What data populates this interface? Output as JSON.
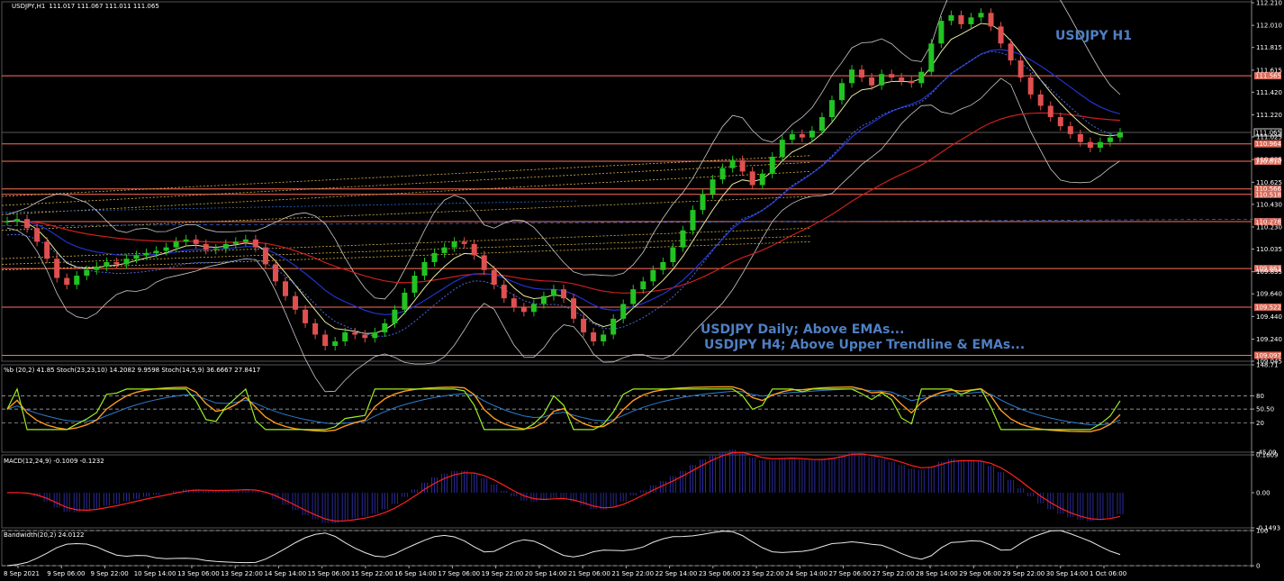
{
  "chart_data": {
    "type": "line",
    "header": {
      "symbol": "USDJPY,H1",
      "ohlc": "111.017 111.067 111.011 111.065"
    },
    "annotations": {
      "title": "USDJPY H1",
      "note1": "USDJPY Daily; Above EMAs...",
      "note2": "USDJPY H4; Above Upper Trendline & EMAs..."
    },
    "price_axis": {
      "ylim": [
        109.045,
        112.218
      ],
      "ticks": [
        "112.210",
        "112.010",
        "111.815",
        "111.615",
        "111.420",
        "111.220",
        "111.025",
        "110.825",
        "110.625",
        "110.430",
        "110.230",
        "110.035",
        "109.835",
        "109.640",
        "109.440",
        "109.240",
        "109.045"
      ],
      "tick_values": [
        112.21,
        112.01,
        111.815,
        111.615,
        111.42,
        111.22,
        111.025,
        110.825,
        110.625,
        110.43,
        110.23,
        110.035,
        109.835,
        109.64,
        109.44,
        109.24,
        109.045
      ]
    },
    "horizontal_levels": [
      {
        "label": "111.565",
        "value": 111.565
      },
      {
        "label": "110.964",
        "value": 110.964
      },
      {
        "label": "110.810",
        "value": 110.81
      },
      {
        "label": "110.566",
        "value": 110.566
      },
      {
        "label": "110.518",
        "value": 110.518
      },
      {
        "label": "110.278",
        "value": 110.278
      },
      {
        "label": "109.863",
        "value": 109.863
      },
      {
        "label": "109.522",
        "value": 109.522
      },
      {
        "label": "109.097",
        "value": 109.097
      }
    ],
    "current_price": {
      "label": "111.065",
      "value": 111.065
    },
    "price_series": {
      "name": "USDJPY close (approx.)",
      "values": [
        110.28,
        110.3,
        110.22,
        110.1,
        109.95,
        109.78,
        109.72,
        109.8,
        109.85,
        109.88,
        109.92,
        109.9,
        109.95,
        109.98,
        110.0,
        110.02,
        110.05,
        110.1,
        110.12,
        110.08,
        110.03,
        110.04,
        110.08,
        110.1,
        110.12,
        110.05,
        109.9,
        109.75,
        109.62,
        109.5,
        109.38,
        109.28,
        109.18,
        109.22,
        109.3,
        109.28,
        109.25,
        109.3,
        109.38,
        109.5,
        109.65,
        109.8,
        109.92,
        110.0,
        110.05,
        110.1,
        110.08,
        109.98,
        109.85,
        109.72,
        109.6,
        109.52,
        109.48,
        109.55,
        109.62,
        109.68,
        109.6,
        109.42,
        109.3,
        109.22,
        109.28,
        109.42,
        109.55,
        109.68,
        109.75,
        109.85,
        109.92,
        110.05,
        110.2,
        110.38,
        110.52,
        110.65,
        110.75,
        110.82,
        110.72,
        110.6,
        110.7,
        110.85,
        111.0,
        111.05,
        111.02,
        111.08,
        111.2,
        111.35,
        111.5,
        111.62,
        111.55,
        111.48,
        111.58,
        111.55,
        111.52,
        111.5,
        111.6,
        111.85,
        112.05,
        112.1,
        112.02,
        112.08,
        112.12,
        112.0,
        111.85,
        111.7,
        111.55,
        111.4,
        111.3,
        111.2,
        111.12,
        111.05,
        110.98,
        110.93,
        110.98,
        111.02,
        111.065
      ]
    },
    "indicators": {
      "stoch_panel": {
        "header": "%b (20,2) 41.85  Stoch(23,23,10) 14.2082 9.9598  Stoch(14,5,9) 36.6667 27.8417",
        "axis_ticks": [
          "148.71",
          "80",
          "50.50",
          "20",
          "-45.09"
        ],
        "tick_values": [
          148.71,
          80,
          50.5,
          20,
          -45.09
        ],
        "ylim": [
          -45.09,
          148.71
        ]
      },
      "macd_panel": {
        "header": "MACD(12,24,9) -0.1009 -0.1232",
        "axis_ticks": [
          "0.1609",
          "0.00",
          "-0.1493"
        ],
        "tick_values": [
          0.1609,
          0,
          -0.1493
        ],
        "ylim": [
          -0.1493,
          0.1609
        ]
      },
      "bandwidth_panel": {
        "header": "Bandwidth(20,2) 24.0122",
        "axis_ticks": [
          "100",
          "0"
        ],
        "tick_values": [
          100,
          0
        ],
        "ylim": [
          0,
          100
        ]
      }
    },
    "x_labels": [
      "8 Sep 2021",
      "9 Sep 06:00",
      "9 Sep 22:00",
      "10 Sep 14:00",
      "13 Sep 06:00",
      "13 Sep 22:00",
      "14 Sep 14:00",
      "15 Sep 06:00",
      "15 Sep 22:00",
      "16 Sep 14:00",
      "17 Sep 06:00",
      "19 Sep 22:00",
      "20 Sep 14:00",
      "21 Sep 06:00",
      "21 Sep 22:00",
      "22 Sep 14:00",
      "23 Sep 06:00",
      "23 Sep 22:00",
      "24 Sep 14:00",
      "27 Sep 06:00",
      "27 Sep 22:00",
      "28 Sep 14:00",
      "29 Sep 06:00",
      "29 Sep 22:00",
      "30 Sep 14:00",
      "1 Oct 06:00"
    ],
    "colors": {
      "background": "#000000",
      "bull": "#22c322",
      "bear": "#e05050",
      "level_line": "#ff6f5a",
      "ema_slow": "#cc1f1f",
      "ema_mid": "#2233cc",
      "ema_fast": "#e8e8a0",
      "bands": "#c8c8c8",
      "stoch_green": "#9cee22",
      "stoch_orange": "#ff9a1e",
      "stoch_blue": "#2a7fd0",
      "macd_signal": "#ff2020",
      "macd_hist": "#2a2a9a",
      "text": "#ffffff",
      "annotation": "#4f7fc3"
    }
  }
}
